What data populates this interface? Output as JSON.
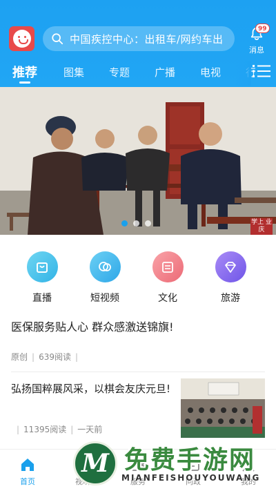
{
  "header": {
    "search_text": "中国疾控中心：出租车/网约车出",
    "message_badge": "99",
    "message_label": "消息",
    "bg_color": "#1da1f2"
  },
  "tabs": [
    {
      "label": "推荐",
      "active": true
    },
    {
      "label": "图集"
    },
    {
      "label": "专题"
    },
    {
      "label": "广播"
    },
    {
      "label": "电视"
    },
    {
      "label": "行"
    }
  ],
  "banner": {
    "stamp_text": "学上 业庆"
  },
  "categories": [
    {
      "label": "直播",
      "icon": "live-icon",
      "color": "#4ec4ea"
    },
    {
      "label": "短视频",
      "icon": "short-video-icon",
      "color": "#4ab8ea"
    },
    {
      "label": "文化",
      "icon": "culture-icon",
      "color": "#f07d86"
    },
    {
      "label": "旅游",
      "icon": "travel-icon",
      "color": "#8a6cf0"
    }
  ],
  "articles": [
    {
      "title": "医保服务贴人心 群众感激送锦旗!",
      "source": "原创",
      "reads": "639阅读"
    },
    {
      "title": "弘扬国粹展风采，以棋会友庆元旦!",
      "reads": "11395阅读",
      "time": "一天前"
    }
  ],
  "bottom_nav": [
    {
      "label": "首页",
      "icon": "home-icon",
      "active": true
    },
    {
      "label": "视听",
      "icon": "video-icon"
    },
    {
      "label": "服务",
      "icon": "service-icon"
    },
    {
      "label": "问政",
      "icon": "question-icon"
    },
    {
      "label": "我的",
      "icon": "profile-icon"
    }
  ],
  "watermark": {
    "title": "免费手游网",
    "subtitle": "MIANFEISHOUYOUWANG"
  }
}
